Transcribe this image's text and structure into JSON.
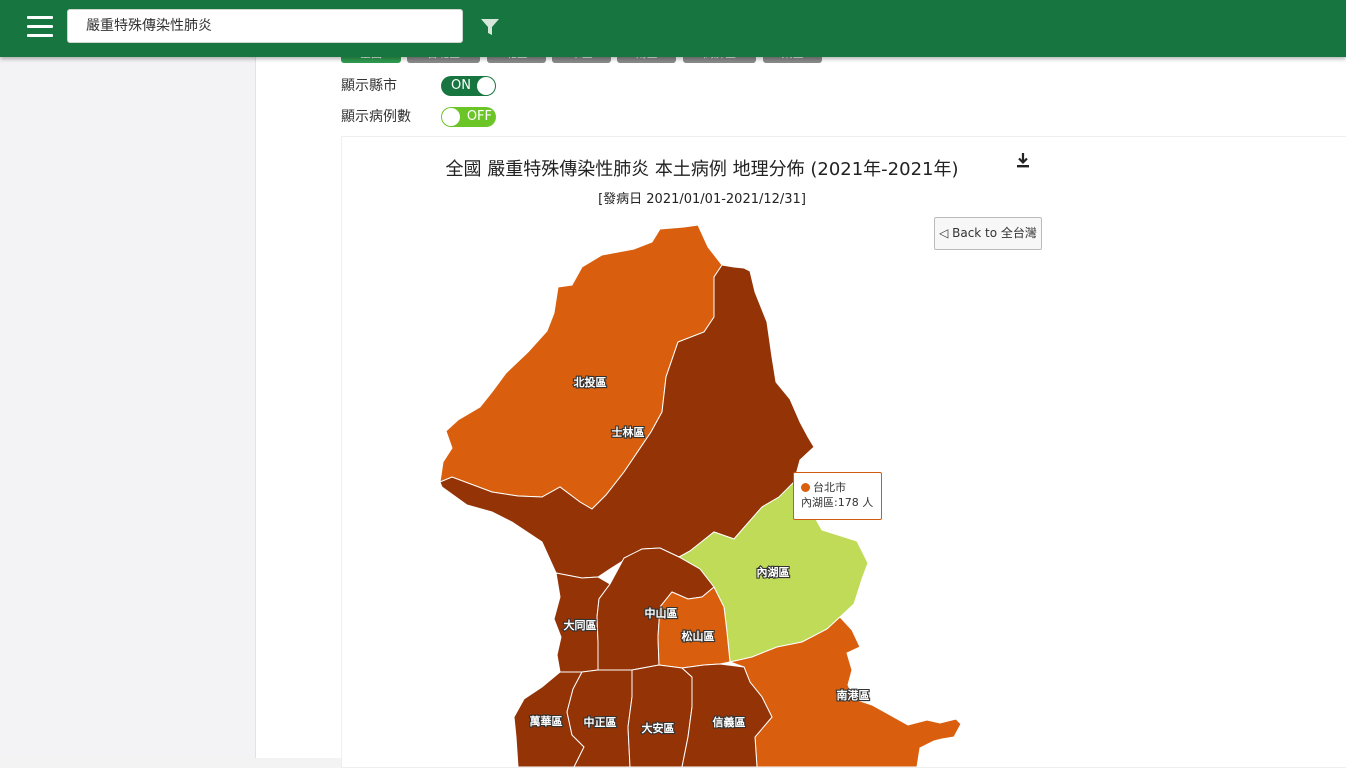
{
  "header": {
    "search_value": "嚴重特殊傳染性肺炎",
    "icons": {
      "menu": "hamburger-menu-icon",
      "filter": "filter-icon"
    }
  },
  "tabs": [
    {
      "label": "全國",
      "active": true
    },
    {
      "label": "台北區",
      "active": false
    },
    {
      "label": "北區",
      "active": false
    },
    {
      "label": "中區",
      "active": false
    },
    {
      "label": "南區",
      "active": false
    },
    {
      "label": "高屏區",
      "active": false
    },
    {
      "label": "東區",
      "active": false
    }
  ],
  "toggles": {
    "county": {
      "label": "顯示縣市",
      "state": "ON"
    },
    "cases": {
      "label": "顯示病例數",
      "state": "OFF"
    }
  },
  "chart": {
    "title": "全國 嚴重特殊傳染性肺炎 本土病例 地理分佈 (2021年-2021年)",
    "subtitle": "[發病日 2021/01/01-2021/12/31]",
    "back_button": "◁ Back to 全台灣",
    "download_icon": "download-icon"
  },
  "colors": {
    "dark": "#933306",
    "orange": "#d95f0e",
    "light": "#bfdb58",
    "header": "#177540"
  },
  "map_regions": [
    {
      "name": "北投區",
      "color": "orange"
    },
    {
      "name": "士林區",
      "color": "dark"
    },
    {
      "name": "內湖區",
      "color": "light"
    },
    {
      "name": "大同區",
      "color": "dark"
    },
    {
      "name": "中山區",
      "color": "dark"
    },
    {
      "name": "松山區",
      "color": "orange"
    },
    {
      "name": "南港區",
      "color": "orange"
    },
    {
      "name": "萬華區",
      "color": "dark"
    },
    {
      "name": "中正區",
      "color": "dark"
    },
    {
      "name": "大安區",
      "color": "dark"
    },
    {
      "name": "信義區",
      "color": "dark"
    }
  ],
  "tooltip": {
    "series": "台北市",
    "text": "內湖區:178 人"
  }
}
